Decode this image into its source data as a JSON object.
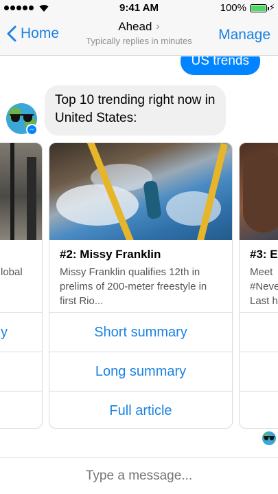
{
  "status_bar": {
    "time": "9:41 AM",
    "battery": "100%"
  },
  "nav": {
    "back_label": "Home",
    "title": "Ahead",
    "subtitle": "Typically replies in minutes",
    "manage_label": "Manage"
  },
  "chat": {
    "user_message": "US trends",
    "bot_message": "Top 10 trending right now in United States:"
  },
  "cards": {
    "left": {
      "desc_partial": "lobal",
      "btn1_partial": "y"
    },
    "main": {
      "title": "#2: Missy Franklin",
      "description": "Missy Franklin qualifies 12th in prelims of 200-meter freestyle in first Rio...",
      "buttons": [
        "Short summary",
        "Long summary",
        "Full article"
      ]
    },
    "right": {
      "title_partial": "#3: E",
      "desc_partial": "Meet\n#Neve\nLast h"
    }
  },
  "composer": {
    "placeholder": "Type a message..."
  },
  "colors": {
    "accent": "#1a82e2",
    "bubble_user": "#0084ff",
    "bubble_bot": "#f1f0f0"
  }
}
